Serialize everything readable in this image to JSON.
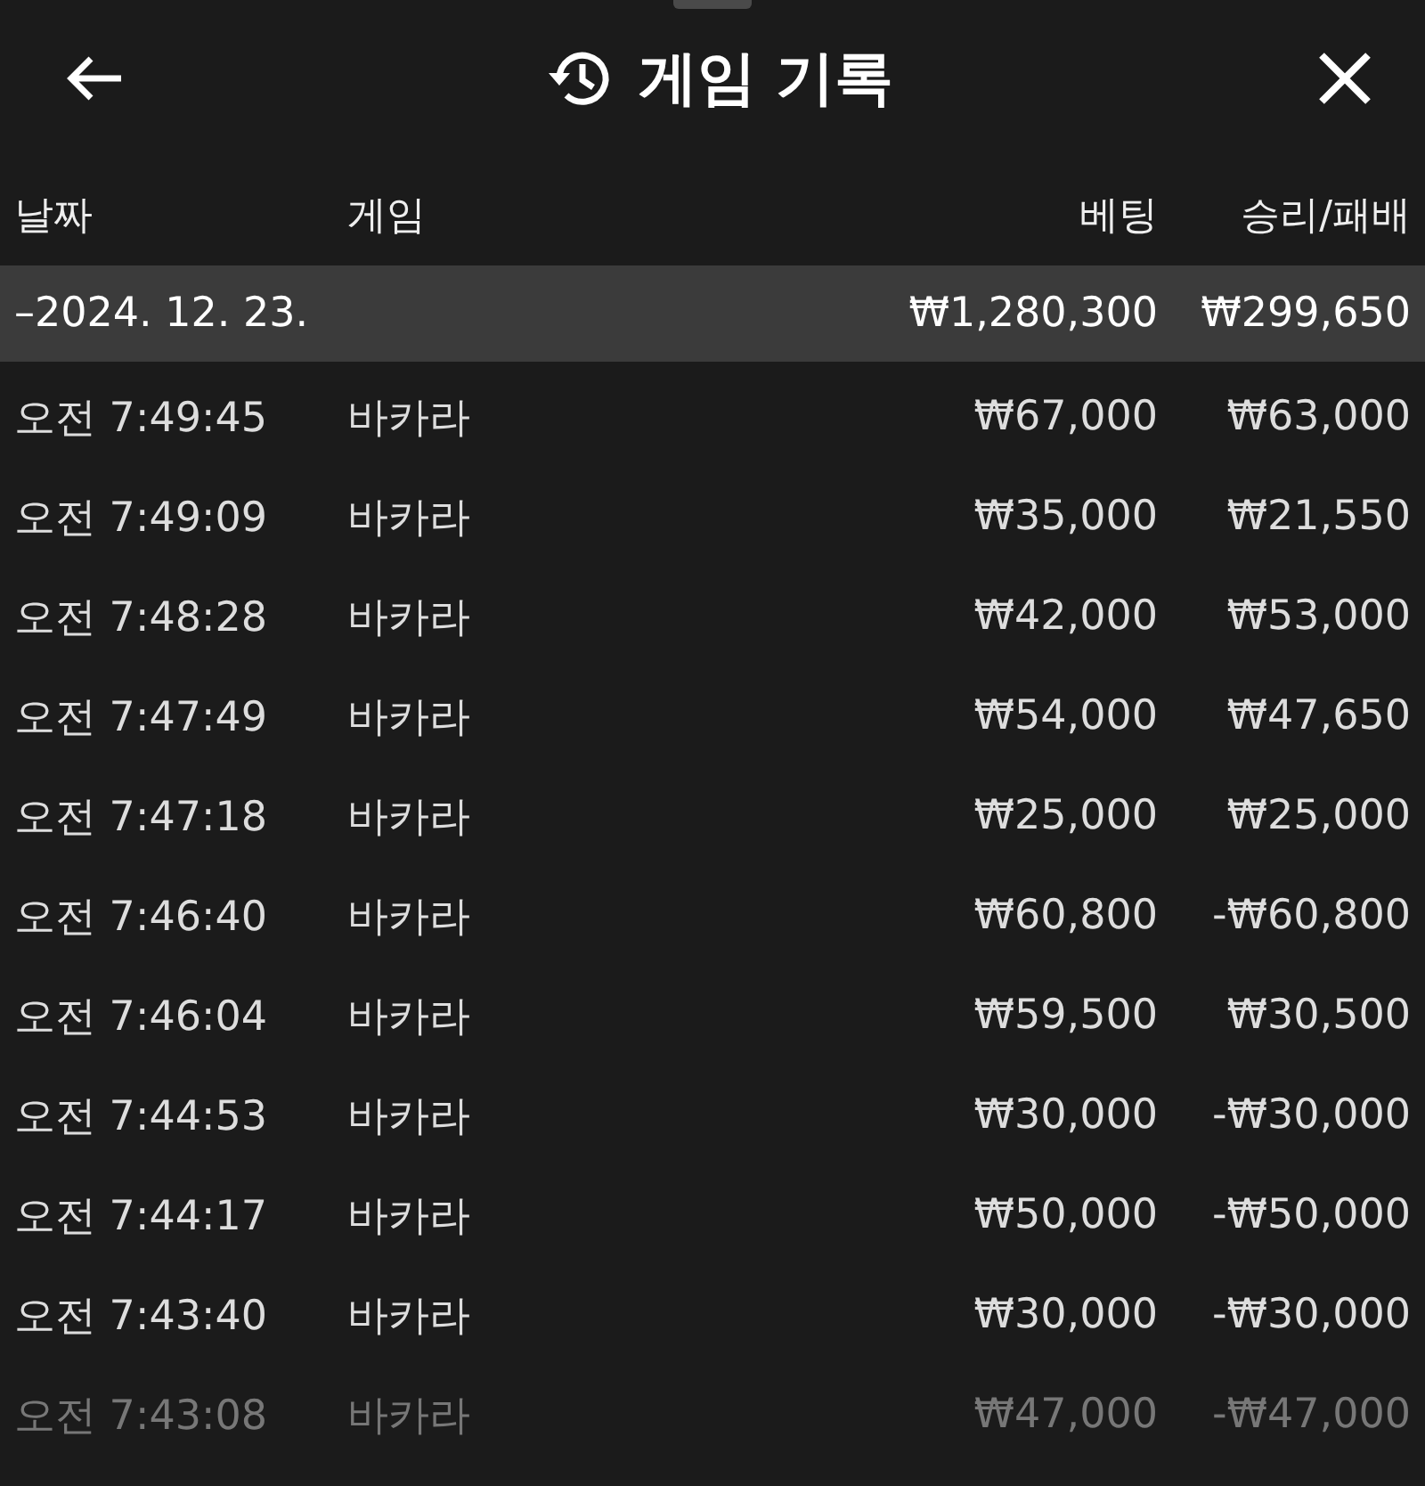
{
  "header": {
    "title": "게임 기록"
  },
  "table": {
    "columns": [
      "날짜",
      "게임",
      "베팅",
      "승리/패배"
    ],
    "group": {
      "date": "–2024. 12. 23.",
      "bet": "₩1,280,300",
      "result": "₩299,650"
    },
    "rows": [
      {
        "time": "오전 7:49:45",
        "game": "바카라",
        "bet": "₩67,000",
        "result": "₩63,000"
      },
      {
        "time": "오전 7:49:09",
        "game": "바카라",
        "bet": "₩35,000",
        "result": "₩21,550"
      },
      {
        "time": "오전 7:48:28",
        "game": "바카라",
        "bet": "₩42,000",
        "result": "₩53,000"
      },
      {
        "time": "오전 7:47:49",
        "game": "바카라",
        "bet": "₩54,000",
        "result": "₩47,650"
      },
      {
        "time": "오전 7:47:18",
        "game": "바카라",
        "bet": "₩25,000",
        "result": "₩25,000"
      },
      {
        "time": "오전 7:46:40",
        "game": "바카라",
        "bet": "₩60,800",
        "result": "-₩60,800"
      },
      {
        "time": "오전 7:46:04",
        "game": "바카라",
        "bet": "₩59,500",
        "result": "₩30,500"
      },
      {
        "time": "오전 7:44:53",
        "game": "바카라",
        "bet": "₩30,000",
        "result": "-₩30,000"
      },
      {
        "time": "오전 7:44:17",
        "game": "바카라",
        "bet": "₩50,000",
        "result": "-₩50,000"
      },
      {
        "time": "오전 7:43:40",
        "game": "바카라",
        "bet": "₩30,000",
        "result": "-₩30,000"
      },
      {
        "time": "오전 7:43:08",
        "game": "바카라",
        "bet": "₩47,000",
        "result": "-₩47,000"
      }
    ]
  }
}
